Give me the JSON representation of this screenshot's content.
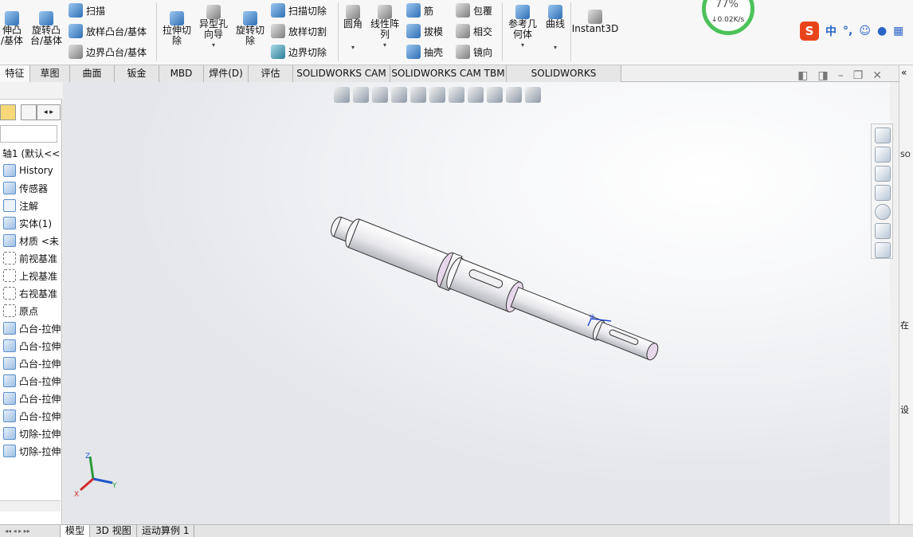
{
  "ribbon": {
    "left_cut": "伸凸\n/基体",
    "revolve_boss": "旋转凸\n台/基体",
    "sweep": "扫描",
    "loft_boss": "放样凸台/基体",
    "boundary_boss": "边界凸台/基体",
    "extrude_cut": "拉伸切\n除",
    "hole_wizard": "异型孔\n向导",
    "revolve_cut": "旋转切\n除",
    "sweep_cut": "扫描切除",
    "loft_cut": "放样切割",
    "boundary_cut": "边界切除",
    "fillet": "圆角",
    "linear_pattern": "线性阵\n列",
    "rib": "筋",
    "draft": "拔模",
    "shell": "抽壳",
    "wrap": "包覆",
    "intersect": "相交",
    "mirror": "镜向",
    "ref_geometry": "参考几\n何体",
    "curves": "曲线",
    "instant3d": "Instant3D"
  },
  "network": {
    "percent": "77%",
    "speed": "↓0.02K/s"
  },
  "ime": {
    "logo": "S",
    "mode": "中",
    "punct": "°,"
  },
  "tabs": [
    {
      "label": "特征"
    },
    {
      "label": "草图"
    },
    {
      "label": "曲面"
    },
    {
      "label": "钣金"
    },
    {
      "label": "MBD"
    },
    {
      "label": "焊件(D)"
    },
    {
      "label": "评估"
    },
    {
      "label": "SOLIDWORKS CAM"
    },
    {
      "label": "SOLIDWORKS CAM TBM"
    },
    {
      "label": "SOLIDWORKS Inspection"
    }
  ],
  "tree": {
    "root": "轴1 (默认<<",
    "items": [
      {
        "label": "History"
      },
      {
        "label": "传感器"
      },
      {
        "label": "注解"
      },
      {
        "label": "实体(1)"
      },
      {
        "label": "材质 <未"
      },
      {
        "label": "前视基准"
      },
      {
        "label": "上视基准"
      },
      {
        "label": "右视基准"
      },
      {
        "label": "原点"
      },
      {
        "label": "凸台-拉伸"
      },
      {
        "label": "凸台-拉伸"
      },
      {
        "label": "凸台-拉伸"
      },
      {
        "label": "凸台-拉伸"
      },
      {
        "label": "凸台-拉伸"
      },
      {
        "label": "凸台-拉伸"
      },
      {
        "label": "切除-拉伸"
      },
      {
        "label": "切除-拉伸"
      }
    ]
  },
  "triad": {
    "x": "X",
    "y": "Y",
    "z": "Z"
  },
  "bottom_tabs": [
    {
      "label": "模型"
    },
    {
      "label": "3D 视图"
    },
    {
      "label": "运动算例 1"
    }
  ],
  "right_strip": {
    "top_label": "«",
    "label_so": "SO",
    "label_zai": "在",
    "label_she": "设"
  }
}
